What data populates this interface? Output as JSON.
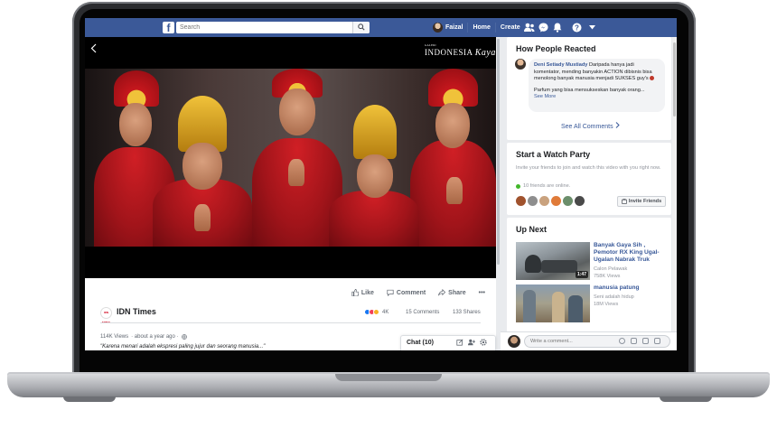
{
  "topbar": {
    "search_placeholder": "Search",
    "profile_name": "Faizal",
    "home": "Home",
    "create": "Create"
  },
  "video": {
    "watermark_top": "GALERI",
    "watermark_main": "INDONESIA",
    "watermark_script": "Kaya"
  },
  "post": {
    "like": "Like",
    "comment": "Comment",
    "share": "Share",
    "more": "•••",
    "page_logo": "IDN TIMES",
    "page_name": "IDN Times",
    "reactions_count": "4K",
    "comments_count": "15 Comments",
    "shares_count": "133 Shares",
    "views": "114K Views",
    "time": "· about a year ago ·",
    "caption": "\"Karena menari adalah ekspresi paling jujur dan seorang manusia...\""
  },
  "chat": {
    "label": "Chat (10)"
  },
  "reacted": {
    "title": "How People Reacted",
    "commenter": "Deni Setiady Mustiady",
    "comment_text": "Daripada hanya jadi komentator, mending banyakin ACTION dibisnis bisa menolong banyak manusia menjadi SUKSES guy's",
    "comment_text2": "Parfum yang bisa mensukseskan banyak orang...",
    "see_more": "See More",
    "see_all": "See All Comments"
  },
  "watch_party": {
    "title": "Start a Watch Party",
    "subtitle": "Invite your friends to join and watch this video with you right now.",
    "online": "10 friends are online.",
    "invite": "Invite Friends"
  },
  "up_next": {
    "title": "Up Next",
    "items": [
      {
        "title": "Banyak Gaya Sih , Pemotor RX King Ugal-Ugalan Nabrak Truk",
        "channel": "Calon Pelawak",
        "views": "758K Views",
        "duration": "1:47"
      },
      {
        "title": "manusia patung",
        "channel": "Seni adalah hidup",
        "views": "18M Views",
        "duration": ""
      }
    ]
  },
  "comment_bar": {
    "placeholder": "Write a comment..."
  },
  "colors": {
    "fb_blue": "#3b5998",
    "link": "#385898",
    "online": "#42b72a"
  }
}
